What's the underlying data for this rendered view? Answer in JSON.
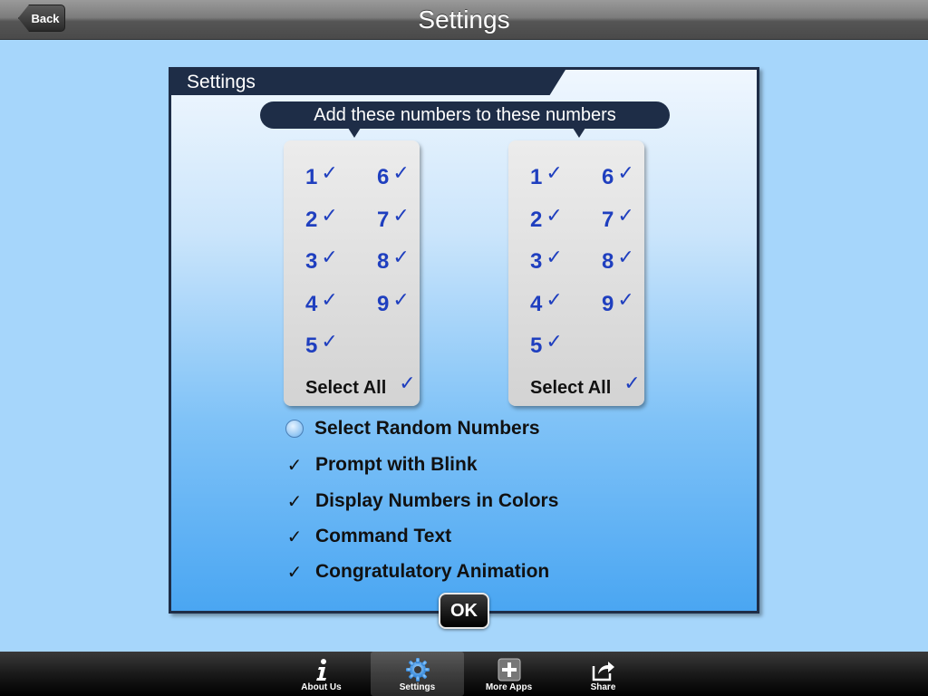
{
  "navbar": {
    "title": "Settings",
    "back_label": "Back"
  },
  "panel": {
    "title": "Settings",
    "header": "Add these numbers to these numbers",
    "left_numbers": [
      "1",
      "2",
      "3",
      "4",
      "5",
      "6",
      "7",
      "8",
      "9"
    ],
    "right_numbers": [
      "1",
      "2",
      "3",
      "4",
      "5",
      "6",
      "7",
      "8",
      "9"
    ],
    "check_glyph": "✓",
    "select_all_label": "Select All",
    "options": [
      {
        "label": "Select Random Numbers",
        "control": "radio",
        "checked": false
      },
      {
        "label": "Prompt with Blink",
        "control": "check",
        "checked": true
      },
      {
        "label": "Display Numbers in Colors",
        "control": "check",
        "checked": true
      },
      {
        "label": "Command Text",
        "control": "check",
        "checked": true
      },
      {
        "label": "Congratulatory Animation",
        "control": "check",
        "checked": true
      }
    ],
    "ok_label": "OK"
  },
  "tabbar": {
    "tabs": [
      {
        "label": "About Us",
        "icon": "info-icon",
        "active": false
      },
      {
        "label": "Settings",
        "icon": "gear-icon",
        "active": true
      },
      {
        "label": "More Apps",
        "icon": "plus-icon",
        "active": false
      },
      {
        "label": "Share",
        "icon": "share-icon",
        "active": false
      }
    ]
  },
  "colors": {
    "background": "#a6d6fb",
    "panel_border": "#1e2d47",
    "number_blue": "#1f3fbf"
  }
}
